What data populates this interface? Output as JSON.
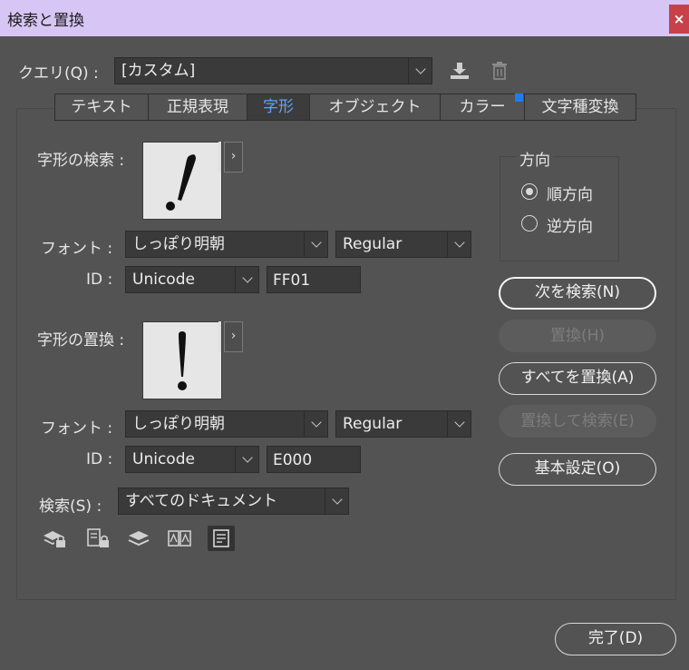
{
  "window": {
    "title": "検索と置換",
    "close_label": "×"
  },
  "query": {
    "label": "クエリ(Q) :",
    "value": "[カスタム]"
  },
  "tabs": [
    {
      "label": "テキスト",
      "active": false
    },
    {
      "label": "正規表現",
      "active": false
    },
    {
      "label": "字形",
      "active": true
    },
    {
      "label": "オブジェクト",
      "active": false
    },
    {
      "label": "カラー",
      "active": false
    },
    {
      "label": "文字種変換",
      "active": false
    }
  ],
  "find": {
    "label": "字形の検索 :",
    "glyph": "！",
    "font_label": "フォント :",
    "font_value": "しっぽり明朝",
    "style_value": "Regular",
    "id_label": "ID :",
    "id_type": "Unicode",
    "id_value": "FF01"
  },
  "replace": {
    "label": "字形の置換 :",
    "glyph": "!",
    "font_label": "フォント :",
    "font_value": "しっぽり明朝",
    "style_value": "Regular",
    "id_label": "ID :",
    "id_type": "Unicode",
    "id_value": "E000"
  },
  "search": {
    "label": "検索(S) :",
    "value": "すべてのドキュメント"
  },
  "direction": {
    "title": "方向",
    "forward": "順方向",
    "backward": "逆方向",
    "selected": "forward"
  },
  "buttons": {
    "find_next": "次を検索(N)",
    "replace": "置換(H)",
    "replace_all": "すべてを置換(A)",
    "replace_find": "置換して検索(E)",
    "basic": "基本設定(O)",
    "done": "完了(D)"
  },
  "more_arrow": "›",
  "colors": {
    "titlebar": "#d7c5f5",
    "active_tab_text": "#5aa5ff",
    "close": "#c8414a",
    "tab_dot": "#1e7cf2"
  }
}
